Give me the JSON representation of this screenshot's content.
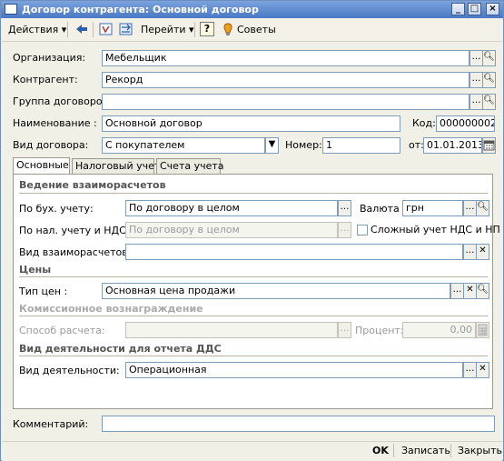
{
  "window": {
    "title": "Договор контрагента: Основной договор"
  },
  "toolbar": {
    "actions_label": "Действия",
    "goto_label": "Перейти",
    "tips_label": "Советы"
  },
  "form": {
    "org_label": "Организация:",
    "org_value": "Мебельщик",
    "counterparty_label": "Контрагент:",
    "counterparty_value": "Рекорд",
    "group_label": "Группа договоров:",
    "group_value": "",
    "name_label": "Наименование :",
    "name_value": "Основной договор",
    "code_label": "Код:",
    "code_value": "000000002",
    "type_label": "Вид договора:",
    "type_value": "С покупателем",
    "number_label": "Номер:",
    "number_value": "1",
    "date_label": "от:",
    "date_value": "01.01.2013"
  },
  "tabs": [
    "Основные",
    "Налоговый учет",
    "Счета учета"
  ],
  "main": {
    "settlements_section": "Ведение взаиморасчетов",
    "acc_label": "По бух. учету:",
    "acc_value": "По договору в целом",
    "currency_label": "Валюта :",
    "currency_value": "грн",
    "tax_label": "По нал. учету и НДС:",
    "tax_value": "По договору в целом",
    "complex_vat_label": "Сложный  учет НДС и НП",
    "settle_type_label": "Вид взаиморасчетов:",
    "settle_type_value": "",
    "prices_section": "Цены",
    "price_type_label": "Тип цен :",
    "price_type_value": "Основная цена продажи",
    "commission_section": "Комиссионное вознаграждение",
    "calc_method_label": "Способ расчета:",
    "calc_method_value": "",
    "percent_label": "Процент:",
    "percent_value": "0,00",
    "activity_section": "Вид деятельности для отчета ДДС",
    "activity_label": "Вид деятельности:",
    "activity_value": "Операционная"
  },
  "comment": {
    "label": "Комментарий:",
    "value": ""
  },
  "bottom": {
    "ok_label": "OK",
    "save_label": "Записать",
    "close_label": "Закрыть"
  }
}
